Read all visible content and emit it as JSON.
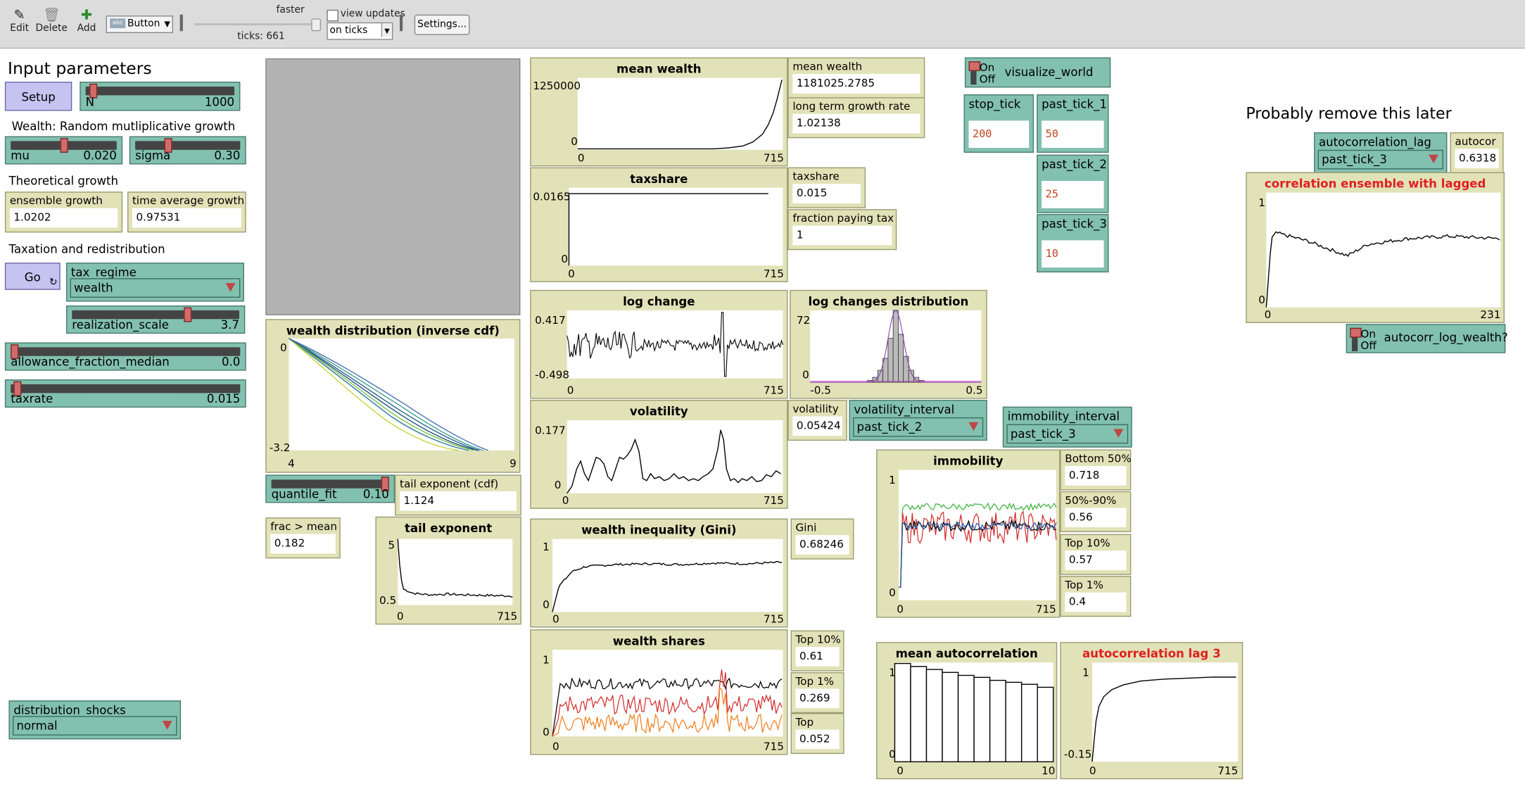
{
  "toolbar": {
    "edit_label": "Edit",
    "delete_label": "Delete",
    "add_label": "Add",
    "widget_type": "Button",
    "speed_label": "faster",
    "ticks_label": "ticks: 661",
    "view_updates_label": "view updates",
    "update_mode": "on ticks",
    "settings_label": "Settings..."
  },
  "notes": {
    "input_parameters": "Input parameters",
    "wealth_growth": "Wealth: Random mutliplicative growth",
    "theoretical_growth": "Theoretical growth",
    "taxation": "Taxation and redistribution",
    "remove_later": "Probably remove this later"
  },
  "buttons": {
    "setup": "Setup",
    "go": "Go"
  },
  "sliders": {
    "N": {
      "label": "N",
      "value": "1000",
      "fraction": 0.03
    },
    "mu": {
      "label": "mu",
      "value": "0.020",
      "fraction": 0.5
    },
    "sigma": {
      "label": "sigma",
      "value": "0.30",
      "fraction": 0.3
    },
    "realization_scale": {
      "label": "realization_scale",
      "value": "3.7",
      "fraction": 0.7
    },
    "allowance_fraction_median": {
      "label": "allowance_fraction_median",
      "value": "0.0",
      "fraction": 0.0
    },
    "taxrate": {
      "label": "taxrate",
      "value": "0.015",
      "fraction": 0.015
    },
    "quantile_fit": {
      "label": "quantile_fit",
      "value": "0.10",
      "fraction": 1.0
    }
  },
  "choosers": {
    "tax_regime": {
      "label": "tax_regime",
      "value": "wealth"
    },
    "distribution_shocks": {
      "label": "distribution_shocks",
      "value": "normal"
    },
    "volatility_interval": {
      "label": "volatility_interval",
      "value": "past_tick_2"
    },
    "immobility_interval": {
      "label": "immobility_interval",
      "value": "past_tick_3"
    },
    "autocorrelation_lag": {
      "label": "autocorrelation_lag",
      "value": "past_tick_3"
    }
  },
  "monitors": {
    "ensemble_growth": {
      "label": "ensemble growth",
      "value": "1.0202"
    },
    "time_average_growth": {
      "label": "time average growth",
      "value": "0.97531"
    },
    "tail_exponent_cdf": {
      "label": "tail exponent (cdf)",
      "value": "1.124"
    },
    "frac_mean": {
      "label": "frac > mean",
      "value": "0.182"
    },
    "mean_wealth": {
      "label": "mean wealth",
      "value": "1181025.2785"
    },
    "long_term_growth": {
      "label": "long term growth rate",
      "value": "1.02138"
    },
    "taxshare": {
      "label": "taxshare",
      "value": "0.015"
    },
    "fraction_paying_tax": {
      "label": "fraction paying tax",
      "value": "1"
    },
    "volatility": {
      "label": "volatility",
      "value": "0.05424"
    },
    "gini": {
      "label": "Gini",
      "value": "0.68246"
    },
    "top10": {
      "label": "Top 10%",
      "value": "0.61"
    },
    "top1": {
      "label": "Top 1%",
      "value": "0.269"
    },
    "top": {
      "label": "Top",
      "value": "0.052"
    },
    "bottom50": {
      "label": "Bottom 50%",
      "value": "0.718"
    },
    "mid50_90": {
      "label": "50%-90%",
      "value": "0.56"
    },
    "imm_top10": {
      "label": "Top 10%",
      "value": "0.57"
    },
    "imm_top1": {
      "label": "Top 1%",
      "value": "0.4"
    },
    "autocor": {
      "label": "autocor",
      "value": "0.6318"
    }
  },
  "inputs": {
    "stop_tick": {
      "label": "stop_tick",
      "value": "200"
    },
    "past_tick_1": {
      "label": "past_tick_1",
      "value": "50"
    },
    "past_tick_2": {
      "label": "past_tick_2",
      "value": "25"
    },
    "past_tick_3": {
      "label": "past_tick_3",
      "value": "10"
    }
  },
  "switches": {
    "visualize_world": {
      "label": "visualize_world",
      "on": "On",
      "off": "Off",
      "state": "off"
    },
    "autocorr_log_wealth": {
      "label": "autocorr_log_wealth?",
      "on": "On",
      "off": "Off",
      "state": "off"
    }
  },
  "plots": {
    "mean_wealth": {
      "title": "mean wealth",
      "ymax": "1250000",
      "ymin": "0",
      "xmin": "0",
      "xmax": "715"
    },
    "taxshare": {
      "title": "taxshare",
      "ymax": "0.0165",
      "ymin": "0",
      "xmin": "0",
      "xmax": "715"
    },
    "log_change": {
      "title": "log change",
      "ymax": "0.417",
      "ymin": "-0.498",
      "xmin": "0",
      "xmax": "715"
    },
    "log_changes_dist": {
      "title": "log changes distribution",
      "ymax": "72",
      "ymin": "0",
      "xmin": "-0.5",
      "xmax": "0.5"
    },
    "volatility": {
      "title": "volatility",
      "ymax": "0.177",
      "ymin": "0",
      "xmin": "0",
      "xmax": "715"
    },
    "wealth_dist": {
      "title": "wealth distribution (inverse cdf)",
      "ymax": "0",
      "ymin": "-3.2",
      "xmin": "4",
      "xmax": "9"
    },
    "tail_exponent": {
      "title": "tail exponent",
      "ymax": "5",
      "ymin": "0.5",
      "xmin": "0",
      "xmax": "715"
    },
    "gini": {
      "title": "wealth inequality (Gini)",
      "ymax": "1",
      "ymin": "0",
      "xmin": "0",
      "xmax": "715"
    },
    "wealth_shares": {
      "title": "wealth shares",
      "ymax": "1",
      "ymin": "0",
      "xmin": "0",
      "xmax": "715"
    },
    "immobility": {
      "title": "immobility",
      "ymax": "1",
      "ymin": "0",
      "xmin": "0",
      "xmax": "715"
    },
    "mean_autocorr": {
      "title": "mean autocorrelation",
      "ymax": "1",
      "ymin": "0",
      "xmin": "0",
      "xmax": "10"
    },
    "autocorr_lag3": {
      "title": "autocorrelation lag 3",
      "ymax": "1",
      "ymin": "-0.15",
      "xmin": "0",
      "xmax": "715"
    },
    "corr_ensemble": {
      "title": "correlation ensemble with lagged",
      "ymax": "1",
      "ymin": "0",
      "xmin": "0",
      "xmax": "231"
    }
  },
  "chart_data": [
    {
      "type": "line",
      "title": "mean wealth",
      "x": [
        0,
        100,
        200,
        300,
        400,
        500,
        550,
        600,
        650,
        680,
        700,
        715
      ],
      "series": [
        {
          "values": [
            0,
            0,
            0,
            0,
            0,
            4000,
            12000,
            40000,
            180000,
            420000,
            800000,
            1181025
          ]
        }
      ],
      "ylim": [
        0,
        1250000
      ],
      "xlim": [
        0,
        715
      ]
    },
    {
      "type": "line",
      "title": "taxshare",
      "x": [
        0,
        715
      ],
      "series": [
        {
          "values": [
            0.015,
            0.015
          ]
        }
      ],
      "ylim": [
        0,
        0.0165
      ],
      "xlim": [
        0,
        715
      ]
    },
    {
      "type": "line",
      "title": "log change",
      "xlim": [
        0,
        715
      ],
      "ylim": [
        -0.498,
        0.417
      ]
    },
    {
      "type": "bar",
      "title": "log changes distribution",
      "categories": [
        -0.15,
        -0.12,
        -0.09,
        -0.06,
        -0.03,
        0,
        0.03,
        0.06,
        0.09,
        0.12,
        0.15
      ],
      "values": [
        2,
        5,
        12,
        24,
        44,
        72,
        48,
        26,
        12,
        5,
        2
      ],
      "xlim": [
        -0.5,
        0.5
      ],
      "ylim": [
        0,
        72
      ]
    },
    {
      "type": "line",
      "title": "volatility",
      "xlim": [
        0,
        715
      ],
      "ylim": [
        0,
        0.177
      ]
    },
    {
      "type": "line",
      "title": "wealth distribution (inverse cdf)",
      "xlim": [
        4,
        9
      ],
      "ylim": [
        -3.2,
        0
      ]
    },
    {
      "type": "line",
      "title": "tail exponent",
      "x": [
        0,
        10,
        30,
        100,
        200,
        300,
        400,
        500,
        600,
        715
      ],
      "series": [
        {
          "values": [
            5,
            3.4,
            1.6,
            1.3,
            1.2,
            1.25,
            1.2,
            1.18,
            1.15,
            1.124
          ]
        }
      ],
      "ylim": [
        0.5,
        5
      ],
      "xlim": [
        0,
        715
      ]
    },
    {
      "type": "line",
      "title": "wealth inequality (Gini)",
      "x": [
        0,
        20,
        60,
        100,
        200,
        300,
        400,
        500,
        600,
        715
      ],
      "series": [
        {
          "values": [
            0,
            0.35,
            0.55,
            0.62,
            0.65,
            0.66,
            0.65,
            0.67,
            0.66,
            0.68
          ]
        }
      ],
      "ylim": [
        0,
        1
      ],
      "xlim": [
        0,
        715
      ]
    },
    {
      "type": "line",
      "title": "wealth shares",
      "xlim": [
        0,
        715
      ],
      "ylim": [
        0,
        1
      ],
      "series": [
        {
          "values": [
            0.61
          ]
        },
        {
          "values": [
            0.269
          ]
        },
        {
          "values": [
            0.052
          ]
        }
      ]
    },
    {
      "type": "line",
      "title": "immobility",
      "xlim": [
        0,
        715
      ],
      "ylim": [
        0,
        1
      ],
      "series": [
        {
          "values": [
            0.718
          ]
        },
        {
          "values": [
            0.56
          ]
        },
        {
          "values": [
            0.57
          ]
        },
        {
          "values": [
            0.4
          ]
        }
      ]
    },
    {
      "type": "bar",
      "title": "mean autocorrelation",
      "categories": [
        0,
        1,
        2,
        3,
        4,
        5,
        6,
        7,
        8,
        9
      ],
      "values": [
        0.99,
        0.96,
        0.93,
        0.9,
        0.87,
        0.85,
        0.82,
        0.8,
        0.78,
        0.75
      ],
      "ylim": [
        0,
        1
      ],
      "xlim": [
        0,
        10
      ]
    },
    {
      "type": "line",
      "title": "autocorrelation lag 3",
      "x": [
        0,
        5,
        10,
        20,
        40,
        80,
        150,
        300,
        500,
        715
      ],
      "series": [
        {
          "values": [
            -0.15,
            0.2,
            0.45,
            0.6,
            0.72,
            0.82,
            0.88,
            0.92,
            0.94,
            0.95
          ]
        }
      ],
      "ylim": [
        -0.15,
        1
      ],
      "xlim": [
        0,
        715
      ]
    },
    {
      "type": "line",
      "title": "correlation ensemble with lagged",
      "x": [
        0,
        5,
        10,
        40,
        80,
        100,
        140,
        180,
        231
      ],
      "series": [
        {
          "values": [
            0,
            0.6,
            0.65,
            0.58,
            0.45,
            0.55,
            0.6,
            0.62,
            0.6
          ]
        }
      ],
      "ylim": [
        0,
        1
      ],
      "xlim": [
        0,
        231
      ]
    }
  ]
}
